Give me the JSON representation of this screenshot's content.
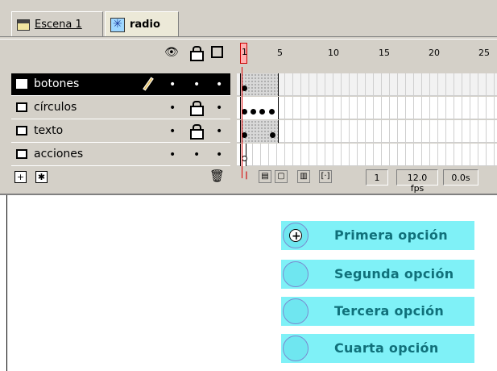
{
  "scene_bar": {
    "scene_label": "Escena 1",
    "symbol_label": "radio",
    "icons": [
      "clapperboard-icon",
      "movieclip-symbol-icon"
    ]
  },
  "timeline": {
    "header_icons": [
      "eye-icon",
      "lock-icon",
      "outline-square-icon"
    ],
    "ruler_labels": [
      "1",
      "5",
      "10",
      "15",
      "20",
      "25"
    ],
    "layers": [
      {
        "name": "botones",
        "selected": true,
        "editing": true,
        "locked": false
      },
      {
        "name": "círculos",
        "selected": false,
        "editing": false,
        "locked": true
      },
      {
        "name": "texto",
        "selected": false,
        "editing": false,
        "locked": true
      },
      {
        "name": "acciones",
        "selected": false,
        "editing": false,
        "locked": false
      }
    ],
    "footer": {
      "current_frame": "1",
      "frame_rate": "12.0 fps",
      "elapsed": "0.0s",
      "left_icons": [
        "add-layer-icon",
        "add-guide-layer-icon"
      ],
      "right_icon": "trash-icon",
      "nav_icons": [
        "center-frame-icon",
        "onion-skin-icon",
        "onion-skin-outlines-icon",
        "edit-multiple-frames-icon",
        "modify-onion-markers-icon"
      ]
    }
  },
  "stage": {
    "options": [
      {
        "label": "Primera opción",
        "selected": true
      },
      {
        "label": "Segunda opción",
        "selected": false
      },
      {
        "label": "Tercera opción",
        "selected": false
      },
      {
        "label": "Cuarta opción",
        "selected": false
      }
    ],
    "option_color": "#7ff1f7",
    "label_color": "#10707a"
  }
}
